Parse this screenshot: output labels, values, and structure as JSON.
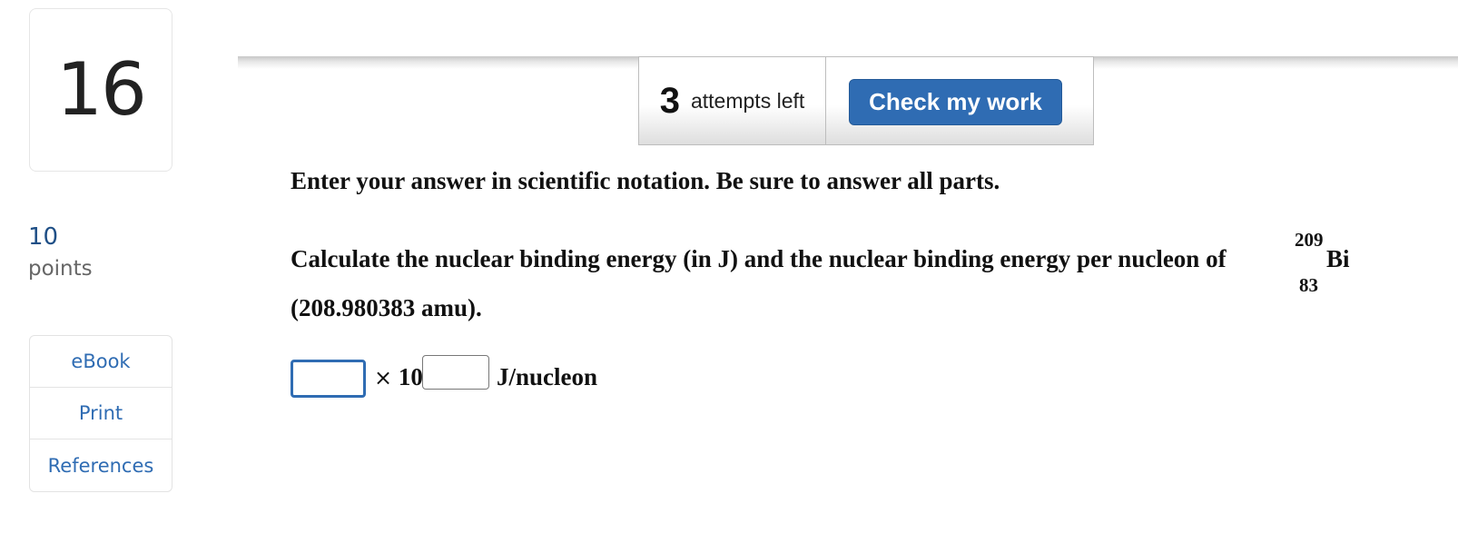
{
  "question": {
    "number": "16",
    "points_value": "10",
    "points_label": "points"
  },
  "resources": {
    "items": [
      {
        "label": "eBook"
      },
      {
        "label": "Print"
      },
      {
        "label": "References"
      }
    ]
  },
  "toolbar": {
    "attempts_count": "3",
    "attempts_text": "attempts left",
    "check_label": "Check my work"
  },
  "content": {
    "instructions": "Enter your answer in scientific notation. Be sure to answer all parts.",
    "question_text": "Calculate the nuclear binding energy (in J) and the nuclear binding energy per nucleon of",
    "isotope": {
      "mass_number": "209",
      "atomic_number": "83",
      "symbol": "Bi"
    },
    "question_text_2": "(208.980383 amu)."
  },
  "answer": {
    "mantissa_value": "",
    "times_sign": "×",
    "base": "10",
    "exponent_value": "",
    "unit": "J/nucleon"
  },
  "colors": {
    "accent": "#2f6cb3",
    "points_number": "#1f4f86"
  }
}
